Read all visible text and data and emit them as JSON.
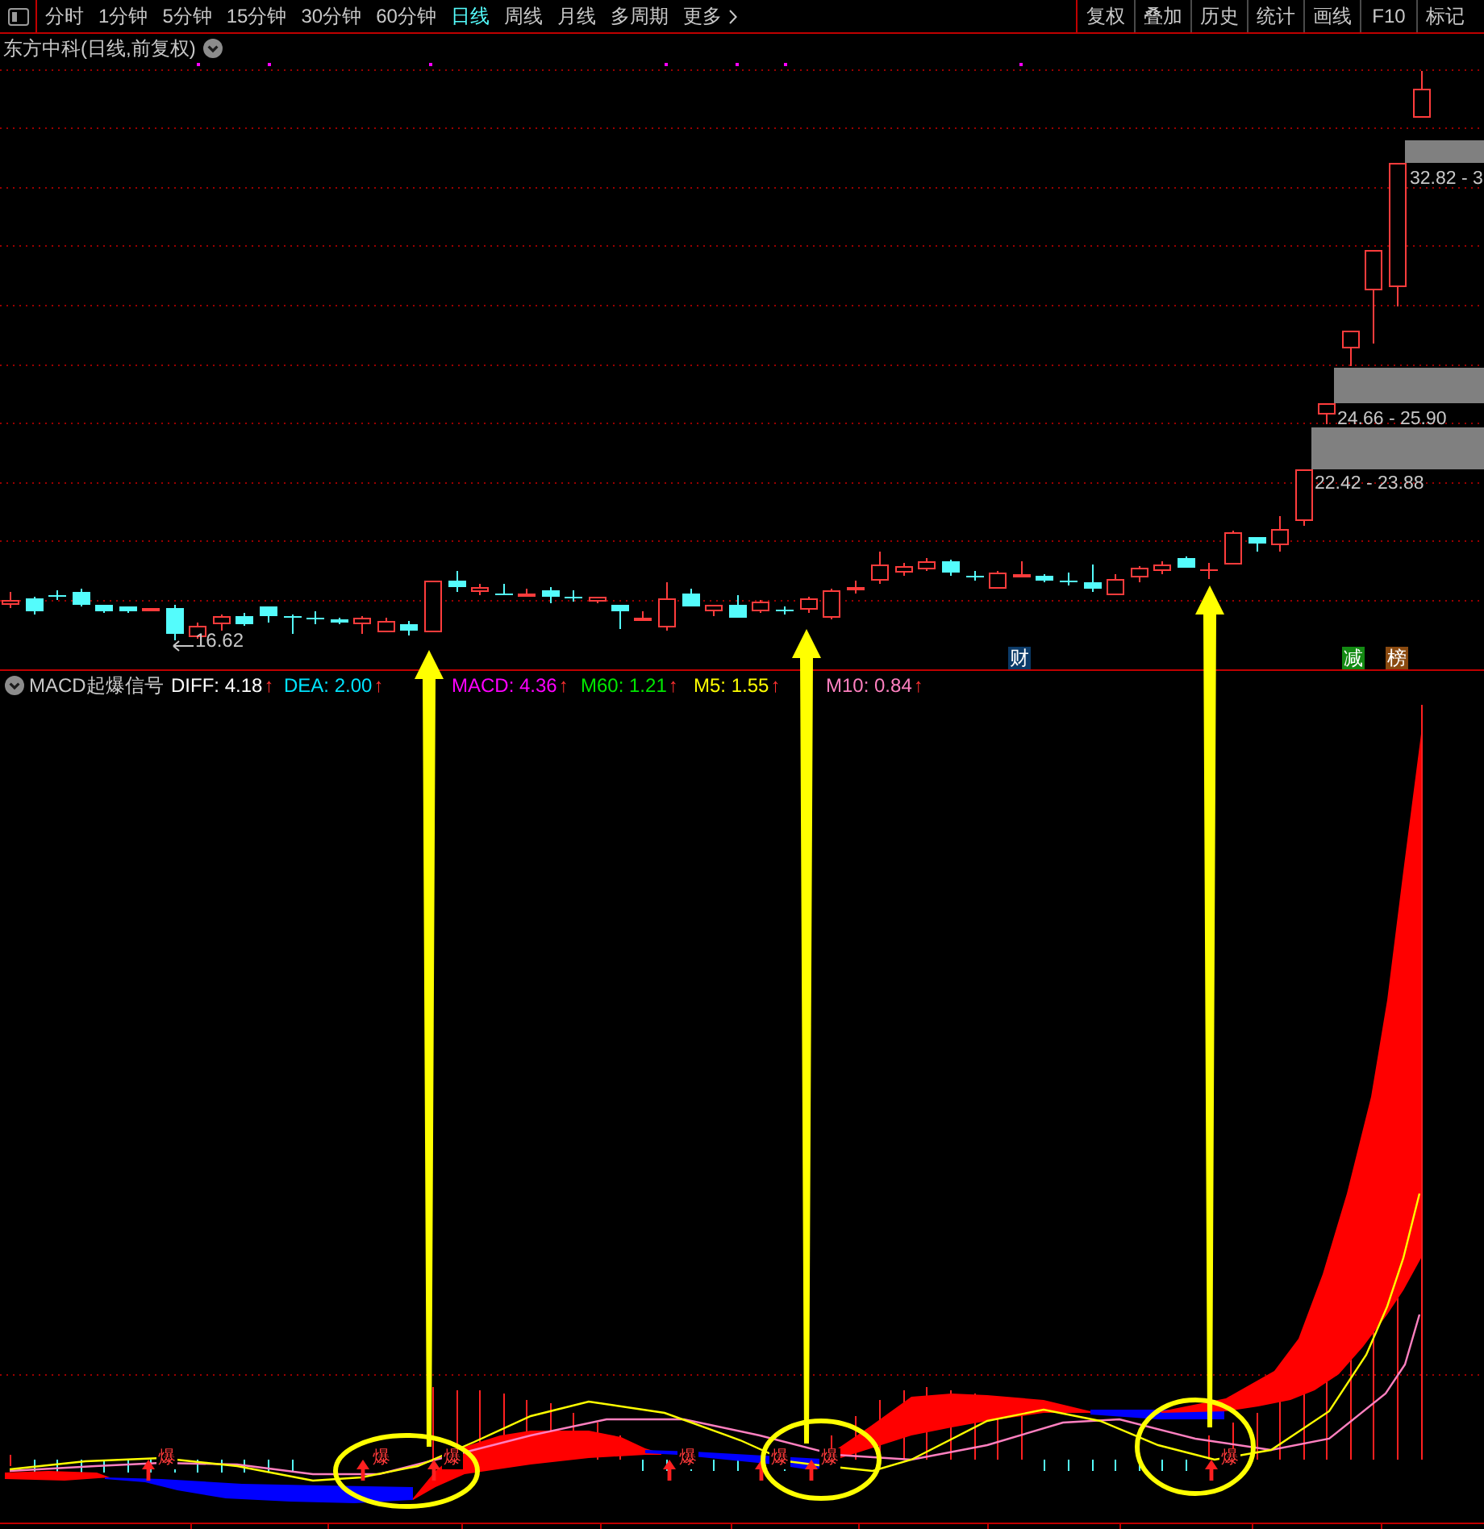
{
  "toolbar": {
    "periods": [
      {
        "label": "分时",
        "selected": false
      },
      {
        "label": "1分钟",
        "selected": false
      },
      {
        "label": "5分钟",
        "selected": false
      },
      {
        "label": "15分钟",
        "selected": false
      },
      {
        "label": "30分钟",
        "selected": false
      },
      {
        "label": "60分钟",
        "selected": false
      },
      {
        "label": "日线",
        "selected": true
      },
      {
        "label": "周线",
        "selected": false
      },
      {
        "label": "月线",
        "selected": false
      },
      {
        "label": "多周期",
        "selected": false
      }
    ],
    "more": {
      "label": "更多"
    },
    "tools": [
      "复权",
      "叠加",
      "历史",
      "统计",
      "画线",
      "F10",
      "标记"
    ]
  },
  "price_chart": {
    "title": "东方中科(日线,前复权)",
    "low_label": "16.62",
    "gap_zones": [
      {
        "label": "32.82 - 3"
      },
      {
        "label": "24.66 - 25.90"
      },
      {
        "label": "22.42 - 23.88"
      }
    ],
    "event_tags": [
      {
        "label": "财",
        "color": "#0b3a68"
      },
      {
        "label": "减",
        "color": "#138a13"
      },
      {
        "label": "榜",
        "color": "#8a4a10"
      }
    ]
  },
  "indicator": {
    "name": "MACD起爆信号",
    "values": [
      {
        "label": "DIFF: 4.18",
        "trend": "↑",
        "color": "#ffffff"
      },
      {
        "label": "DEA: 2.00",
        "trend": "↑",
        "color": "#00e4ff"
      },
      {
        "label": "MACD: 4.36",
        "trend": "↑",
        "color": "#ff00ff"
      },
      {
        "label": "M60: 1.21",
        "trend": "↑",
        "color": "#00e800"
      },
      {
        "label": "M5: 1.55",
        "trend": "↑",
        "color": "#ffff00"
      },
      {
        "label": "M10: 0.84",
        "trend": "↑",
        "color": "#ff80c0"
      }
    ],
    "signals": [
      {
        "label": "爆"
      },
      {
        "label": "爆"
      },
      {
        "label": "爆"
      },
      {
        "label": "爆"
      },
      {
        "label": "爆"
      },
      {
        "label": "爆"
      },
      {
        "label": "爆"
      }
    ]
  }
}
